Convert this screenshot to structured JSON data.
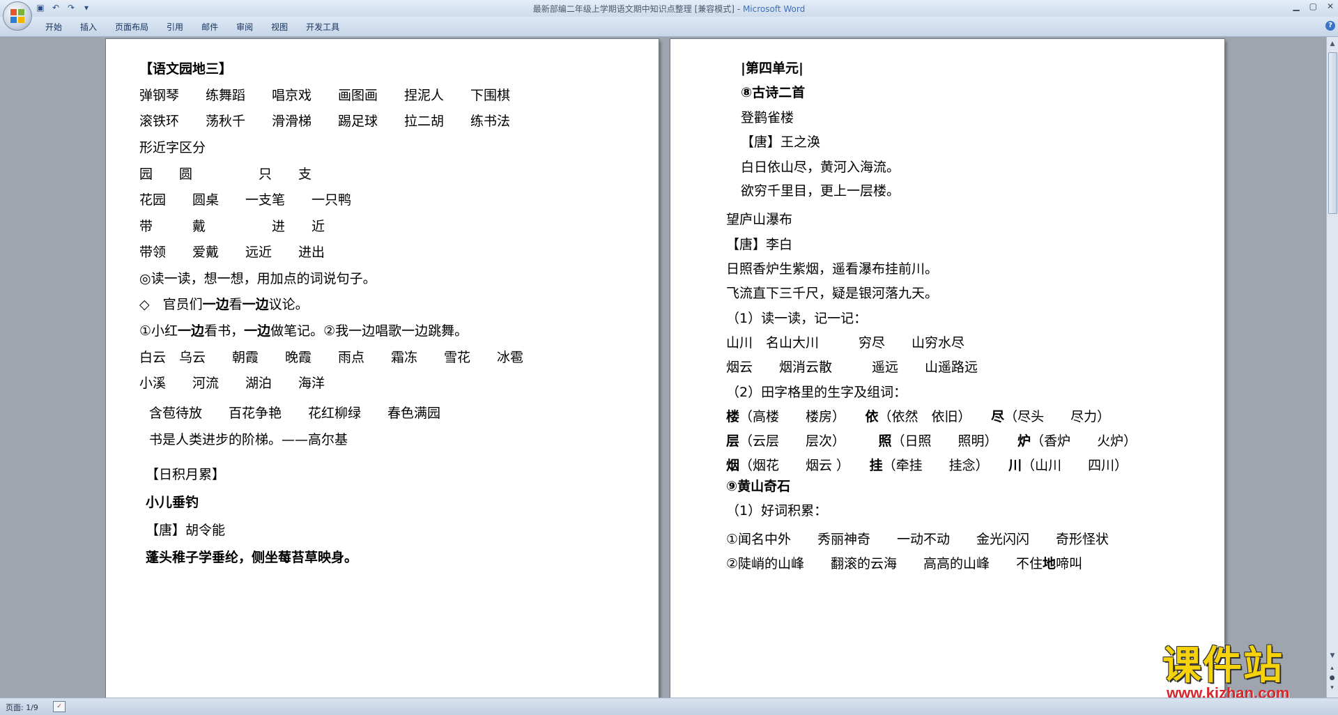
{
  "window": {
    "title": "最新部编二年级上学期语文期中知识点整理 [兼容模式]",
    "title_sep": " - ",
    "app_name": "Microsoft Word"
  },
  "ribbon": {
    "tabs": [
      "开始",
      "插入",
      "页面布局",
      "引用",
      "邮件",
      "审阅",
      "视图",
      "开发工具"
    ]
  },
  "page1": {
    "lines": [
      {
        "segs": [
          {
            "t": "【语文园地三】",
            "b": true
          }
        ]
      },
      {
        "segs": [
          {
            "t": "弹钢琴　　练舞蹈　　唱京戏　　画图画　　捏泥人　　下围棋"
          }
        ]
      },
      {
        "segs": [
          {
            "t": "滚铁环　　荡秋千　　滑滑梯　　踢足球　　拉二胡　　练书法"
          }
        ]
      },
      {
        "segs": [
          {
            "t": "形近字区分"
          }
        ]
      },
      {
        "segs": [
          {
            "t": "园　　圆　　　　　只　　支"
          }
        ]
      },
      {
        "segs": [
          {
            "t": "花园　　圆桌　　一支笔　　一只鸭"
          }
        ]
      },
      {
        "segs": [
          {
            "t": "带　　　戴　　　　　进　　近"
          }
        ]
      },
      {
        "segs": [
          {
            "t": "带领　　爱戴　　远近　　进出"
          }
        ]
      },
      {
        "segs": [
          {
            "t": "◎读一读，想一想，用加点的词说句子。"
          }
        ]
      },
      {
        "segs": [
          {
            "t": "◇　官员们"
          },
          {
            "t": "一边",
            "b": true
          },
          {
            "t": "看"
          },
          {
            "t": "一边",
            "b": true
          },
          {
            "t": "议论。"
          }
        ]
      },
      {
        "segs": [
          {
            "t": "①小红"
          },
          {
            "t": "一边",
            "b": true
          },
          {
            "t": "看书，"
          },
          {
            "t": "一边",
            "b": true
          },
          {
            "t": "做笔记。②我一边唱歌一边跳舞。"
          }
        ]
      },
      {
        "segs": [
          {
            "t": "白云　乌云　　朝霞　　晚霞　　雨点　　霜冻　　雪花　　冰雹"
          }
        ]
      },
      {
        "segs": [
          {
            "t": "小溪　　河流　　湖泊　　海洋"
          }
        ]
      },
      {
        "segs": [
          {
            "t": "含苞待放　　百花争艳　　花红柳绿　　春色满园"
          }
        ]
      },
      {
        "segs": [
          {
            "t": "书是人类进步的阶梯。——高尔基"
          }
        ]
      },
      {
        "segs": [
          {
            "t": "【日积月累】"
          }
        ]
      },
      {
        "segs": [
          {
            "t": "小儿垂钓",
            "b": true
          }
        ]
      },
      {
        "segs": [
          {
            "t": "【唐】胡令能"
          }
        ]
      },
      {
        "segs": [
          {
            "t": "蓬头稚子学垂纶，侧坐莓苔草映身。",
            "b": true
          }
        ]
      }
    ]
  },
  "page2": {
    "lines": [
      {
        "segs": [
          {
            "t": "|第四单元|",
            "b": true
          }
        ]
      },
      {
        "segs": [
          {
            "t": "⑧古诗二首",
            "b": true
          }
        ]
      },
      {
        "segs": [
          {
            "t": "登鹳雀楼"
          }
        ]
      },
      {
        "segs": [
          {
            "t": "【唐】王之涣"
          }
        ]
      },
      {
        "segs": [
          {
            "t": "白日依山尽，黄河入海流。"
          }
        ]
      },
      {
        "segs": [
          {
            "t": "欲穷千里目，更上一层楼。"
          }
        ]
      },
      {
        "segs": [
          {
            "t": "望庐山瀑布"
          }
        ]
      },
      {
        "segs": [
          {
            "t": "【唐】李白"
          }
        ]
      },
      {
        "segs": [
          {
            "t": "日照香炉生紫烟，遥看瀑布挂前川。"
          }
        ]
      },
      {
        "segs": [
          {
            "t": "飞流直下三千尺，疑是银河落九天。"
          }
        ]
      },
      {
        "segs": [
          {
            "t": "（1）读一读，记一记："
          }
        ]
      },
      {
        "segs": [
          {
            "t": "山川　名山大川　　　穷尽　　山穷水尽"
          }
        ]
      },
      {
        "segs": [
          {
            "t": "烟云　　烟消云散　　　遥远　　山遥路远"
          }
        ]
      },
      {
        "segs": [
          {
            "t": "（2）田字格里的生字及组词："
          }
        ]
      },
      {
        "segs": [
          {
            "t": "楼",
            "b": true
          },
          {
            "t": "（高楼　　楼房）　　"
          },
          {
            "t": "依",
            "b": true
          },
          {
            "t": "（依然　依旧）　　"
          },
          {
            "t": "尽",
            "b": true
          },
          {
            "t": "（尽头　　尽力）"
          }
        ]
      },
      {
        "segs": [
          {
            "t": "层",
            "b": true
          },
          {
            "t": "（云层　　层次）　　　"
          },
          {
            "t": "照",
            "b": true
          },
          {
            "t": "（日照　　照明）　　"
          },
          {
            "t": "炉",
            "b": true
          },
          {
            "t": "（香炉　　火炉）"
          }
        ]
      },
      {
        "segs": [
          {
            "t": "烟",
            "b": true
          },
          {
            "t": "（烟花　　烟云 ）　　"
          },
          {
            "t": "挂",
            "b": true
          },
          {
            "t": "（牵挂　　挂念）　　"
          },
          {
            "t": "川",
            "b": true
          },
          {
            "t": "（山川　　四川）"
          }
        ]
      },
      {
        "segs": [
          {
            "t": "⑨黄山奇石",
            "b": true
          }
        ]
      },
      {
        "segs": [
          {
            "t": "（1）好词积累："
          }
        ]
      },
      {
        "segs": [
          {
            "t": "①闻名中外　　秀丽神奇　　一动不动　　金光闪闪　　奇形怪状"
          }
        ]
      },
      {
        "segs": [
          {
            "t": "②陡峭的山峰　　翻滚的云海　　高高的山峰　　不住"
          },
          {
            "t": "地",
            "b": true
          },
          {
            "t": "啼叫"
          }
        ]
      }
    ]
  },
  "status": {
    "page_label": "页面: 1/9"
  },
  "watermark": {
    "title": "课件站",
    "url": "www.kjzhan.com"
  },
  "icons": [
    "office-button-icon",
    "save-icon",
    "undo-icon",
    "redo-icon",
    "customize-qat-icon",
    "minimize-icon",
    "maximize-icon",
    "close-icon",
    "help-icon",
    "scroll-up-icon",
    "scroll-down-icon",
    "prev-page-icon",
    "select-browse-object-icon",
    "next-page-icon",
    "language-icon"
  ]
}
